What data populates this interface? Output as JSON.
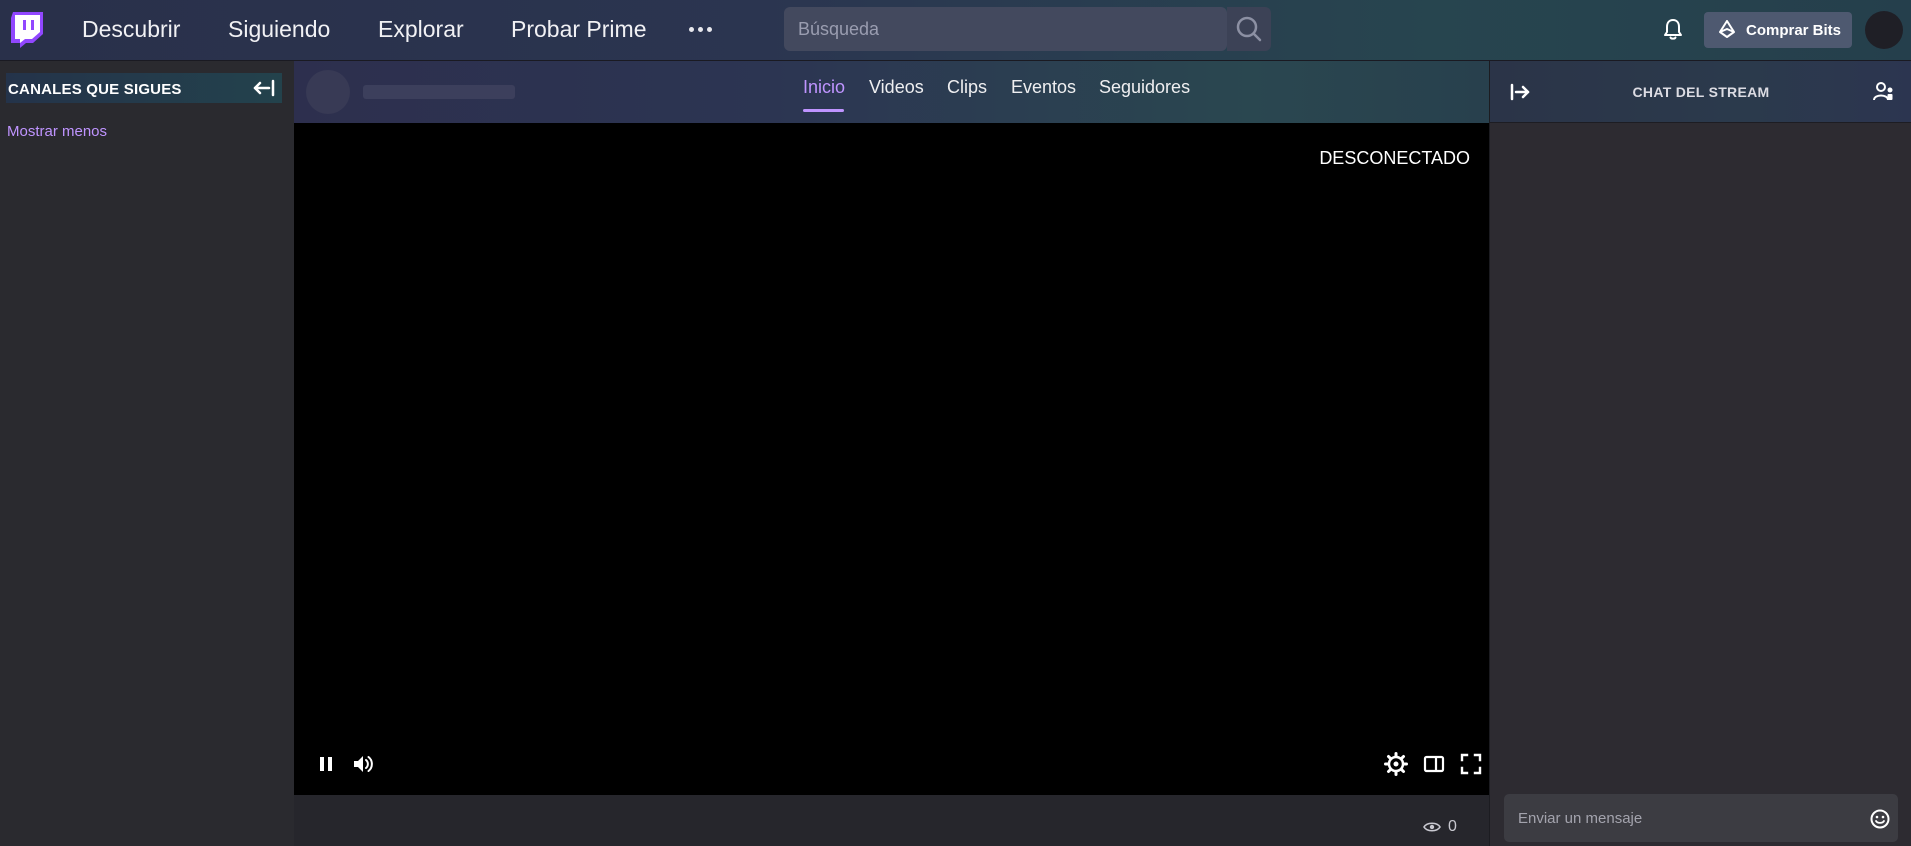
{
  "topbar": {
    "logo_icon": "twitch-logo-icon",
    "nav": [
      "Descubrir",
      "Siguiendo",
      "Explorar",
      "Probar Prime"
    ],
    "more_icon": "more-dots-icon",
    "search": {
      "placeholder": "Búsqueda",
      "value": ""
    },
    "search_icon": "search-icon",
    "bell_icon": "bell-icon",
    "bits_button": {
      "label": "Comprar Bits",
      "icon": "bits-gem-icon"
    },
    "avatar_icon": "user-avatar"
  },
  "sidebar": {
    "title": "CANALES QUE SIGUES",
    "collapse_icon": "collapse-left-icon",
    "show_less": "Mostrar menos"
  },
  "channel": {
    "tabs": [
      "Inicio",
      "Videos",
      "Clips",
      "Eventos",
      "Seguidores"
    ],
    "active_tab": "Inicio"
  },
  "player": {
    "status": "DESCONECTADO",
    "controls_left": [
      "pause-icon",
      "volume-icon"
    ],
    "controls_right": [
      "settings-icon",
      "theatre-mode-icon",
      "fullscreen-icon"
    ],
    "viewer_count": "0",
    "viewer_icon": "eye-icon"
  },
  "chat": {
    "title": "CHAT DEL STREAM",
    "collapse_icon": "expand-right-icon",
    "users_icon": "community-icon",
    "input_placeholder": "Enviar un mensaje",
    "emote_icon": "smiley-icon"
  },
  "colors": {
    "accent": "#bf94ff",
    "logo": "#9147ff",
    "player_bg": "#000000",
    "sidebar_bg": "#2a2a2f"
  }
}
